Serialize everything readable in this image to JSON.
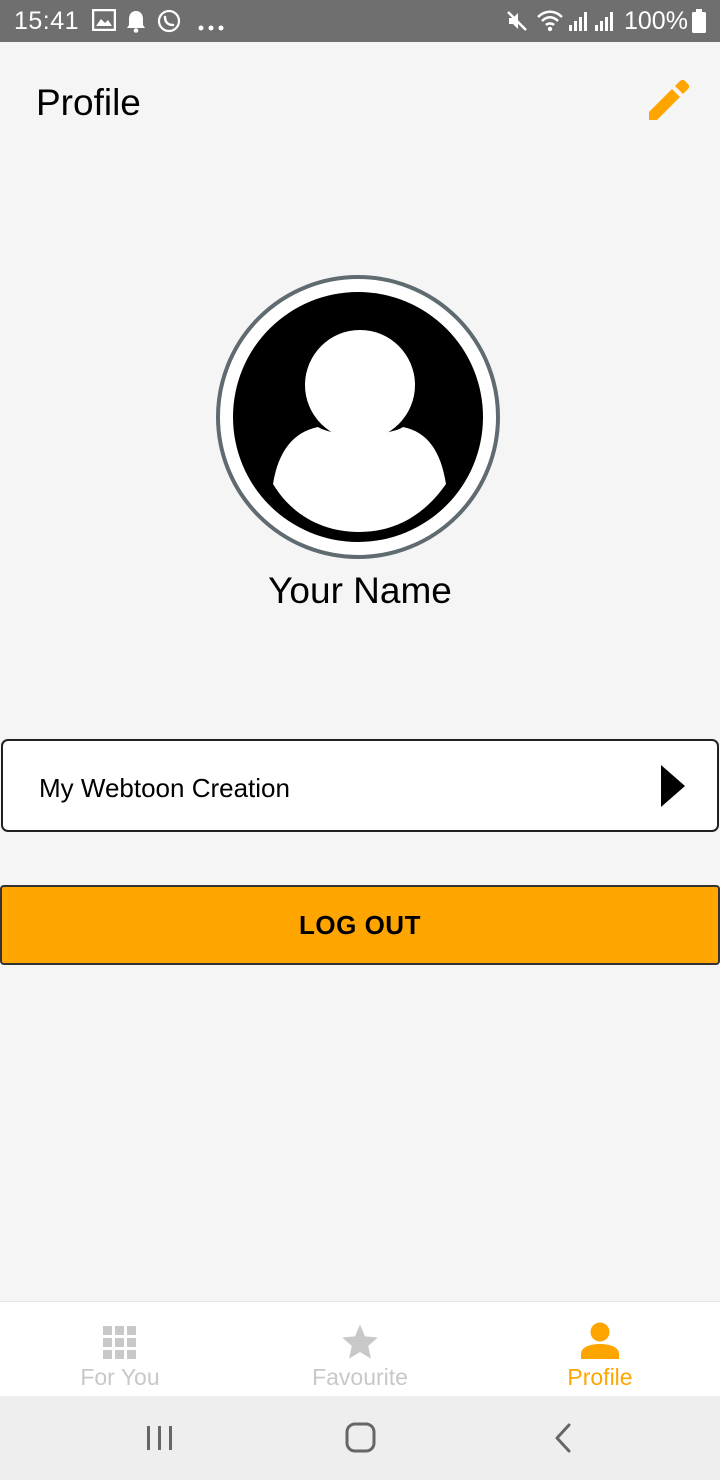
{
  "status_bar": {
    "time": "15:41",
    "battery": "100%",
    "icons": [
      "gallery-icon",
      "notification-bell-icon",
      "whatsapp-icon",
      "more-dots-icon",
      "mute-icon",
      "wifi-icon",
      "signal-icon",
      "battery-icon"
    ]
  },
  "header": {
    "title": "Profile",
    "edit_icon": "pencil-icon"
  },
  "profile": {
    "avatar_icon": "user-avatar-icon",
    "name": "Your Name"
  },
  "menu": {
    "creation_label": "My Webtoon Creation",
    "creation_icon": "triangle-right-icon"
  },
  "logout": {
    "label": "LOG OUT"
  },
  "bottom_nav": {
    "items": [
      {
        "label": "For You",
        "icon": "grid-icon",
        "active": false
      },
      {
        "label": "Favourite",
        "icon": "star-icon",
        "active": false
      },
      {
        "label": "Profile",
        "icon": "person-icon",
        "active": true
      }
    ]
  },
  "system_nav": {
    "buttons": [
      "recent-apps-icon",
      "home-icon",
      "back-icon"
    ]
  },
  "colors": {
    "accent": "#ffa500",
    "inactive_nav": "#c8c8c8",
    "status_bar": "#6f6f6f",
    "background": "#f5f5f5"
  }
}
